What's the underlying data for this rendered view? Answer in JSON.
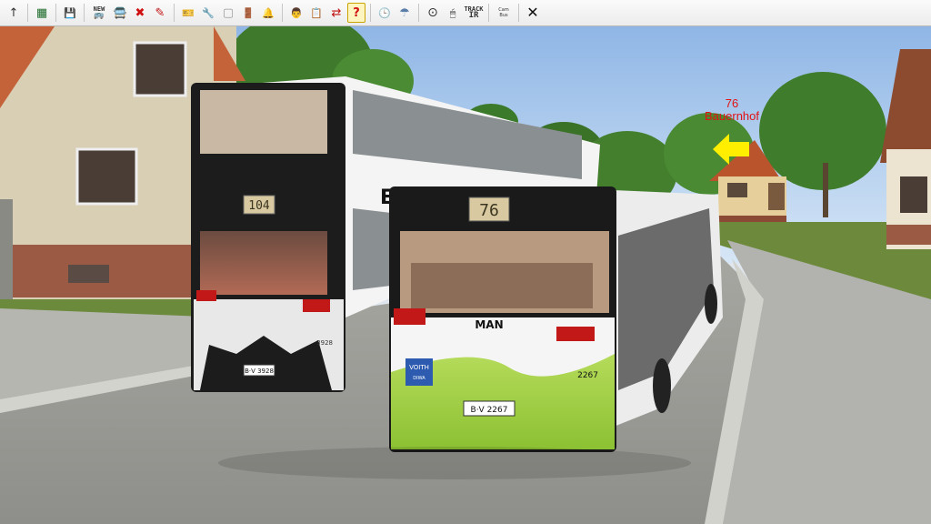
{
  "toolbar": {
    "items": [
      {
        "name": "up-arrow-icon",
        "glyph": "↑"
      },
      {
        "name": "map-icon",
        "glyph": "▦"
      },
      {
        "name": "save-icon",
        "glyph": "💾"
      },
      {
        "name": "new-bus-icon",
        "glyph": "🚌"
      },
      {
        "name": "bus-icon",
        "glyph": "🚍"
      },
      {
        "name": "remove-bus-icon",
        "glyph": "✖"
      },
      {
        "name": "pen-icon",
        "glyph": "✎"
      },
      {
        "name": "ticket-icon",
        "glyph": "🎫"
      },
      {
        "name": "wrench-icon",
        "glyph": "🔧"
      },
      {
        "name": "gray-box-icon",
        "glyph": "▢"
      },
      {
        "name": "door-icon",
        "glyph": "🚪"
      },
      {
        "name": "bell-icon",
        "glyph": "🔔"
      },
      {
        "name": "driver-icon",
        "glyph": "👨"
      },
      {
        "name": "timetable-icon",
        "glyph": "📋"
      },
      {
        "name": "swap-icon",
        "glyph": "⇄"
      },
      {
        "name": "help-icon",
        "glyph": "?"
      },
      {
        "name": "clock-icon",
        "glyph": "🕒"
      },
      {
        "name": "weather-icon",
        "glyph": "☂"
      },
      {
        "name": "camera-icon",
        "glyph": "⊙"
      },
      {
        "name": "mouse-icon",
        "glyph": "🖱"
      },
      {
        "name": "close-icon",
        "glyph": "✕"
      }
    ],
    "new_label": "NEW",
    "track_label_1": "TRACK",
    "track_label_2": "IR",
    "cam_label_1": "Cam",
    "cam_label_2": "Bus"
  },
  "scene": {
    "stop_number": "76",
    "stop_name": "Bauernhof",
    "bus_front_route": "76",
    "bus_front_brand": "MAN",
    "bus_front_fleet": "2267",
    "bus_front_plate": "B·V 2267",
    "bus_front_voith_1": "VOITH",
    "bus_front_voith_2": "DIWA",
    "bus_back_route": "104",
    "bus_back_fleet": "3928",
    "bus_back_plate": "B·V 3928",
    "bus_back_side_text": "E",
    "colors": {
      "sky": "#a8c8ec",
      "grass": "#6d8a3c",
      "road": "#9a9a96",
      "bus_green": "#9acd32",
      "stop_label": "#e11212",
      "arrow": "#ffee00"
    }
  }
}
